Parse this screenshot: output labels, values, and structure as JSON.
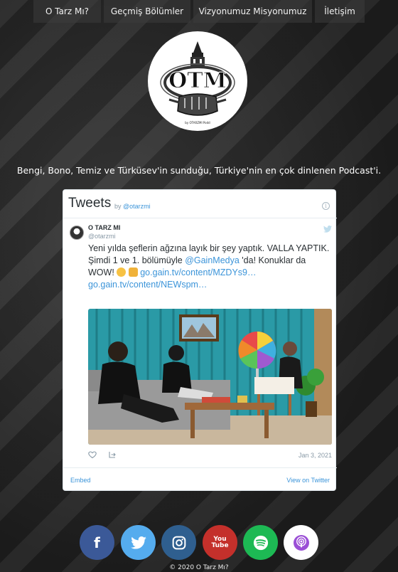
{
  "nav": {
    "items": [
      "O Tarz Mı?",
      "Geçmiş Bölümler",
      "Vizyonumuz Misyonumuz",
      "İletişim"
    ]
  },
  "logo": {
    "letters": "OTM",
    "byline": "by OTARZMI Podd"
  },
  "tagline": "Bengi, Bono, Temiz ve Türküsev'in sunduğu, Türkiye'nin en çok dinlenen Podcast'i.",
  "twitter": {
    "title": "Tweets",
    "by_prefix": "by",
    "by_handle": "@otarzmi",
    "info_icon": "info-icon",
    "tweet": {
      "author_name": "O TARZ MI",
      "author_handle": "@otarzmi",
      "text_part1": "Yeni yılda şeflerin ağzına layık bir şey yaptık. VALLA YAPTIK. Şimdi 1 ve 1. bölümüyle ",
      "mention": "@GainMedya",
      "text_part2": " 'da! Konuklar da WOW! ",
      "link1": "go.gain.tv/content/MZDYs9…",
      "link2": "go.gain.tv/content/NEWspm…",
      "date": "Jan 3, 2021"
    },
    "footer": {
      "embed": "Embed",
      "view": "View on Twitter"
    }
  },
  "social": {
    "facebook": "f",
    "youtube_line1": "You",
    "youtube_line2": "Tube"
  },
  "copyright": "© 2020 O Tarz Mı?",
  "colors": {
    "link": "#3b94d9",
    "facebook": "#3b5998",
    "twitter": "#55acee",
    "instagram": "#2f5f8f",
    "youtube": "#c4302b",
    "spotify": "#1db954",
    "podcasts": "#ffffff"
  }
}
